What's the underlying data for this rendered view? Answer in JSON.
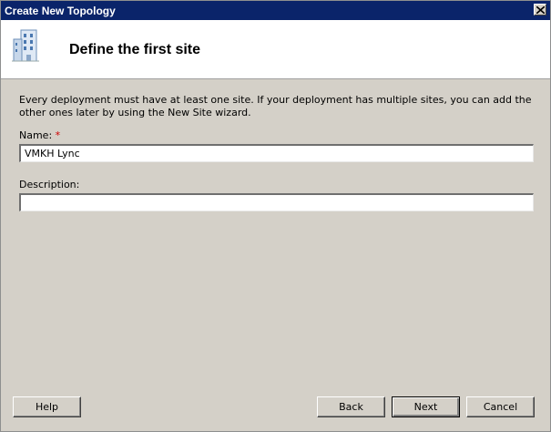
{
  "window": {
    "title": "Create New Topology"
  },
  "header": {
    "title": "Define the first site",
    "icon": "building-icon"
  },
  "intro_text": "Every deployment must have at least one site. If your deployment has multiple sites, you can add the other ones later by using the New Site wizard.",
  "form": {
    "name_label": "Name:",
    "required_marker": "*",
    "name_value": "VMKH Lync",
    "description_label": "Description:",
    "description_value": ""
  },
  "buttons": {
    "help": "Help",
    "back": "Back",
    "next": "Next",
    "cancel": "Cancel"
  },
  "colors": {
    "titlebar": "#0a246a",
    "dialog_bg": "#d4d0c8",
    "required": "#d00000"
  }
}
